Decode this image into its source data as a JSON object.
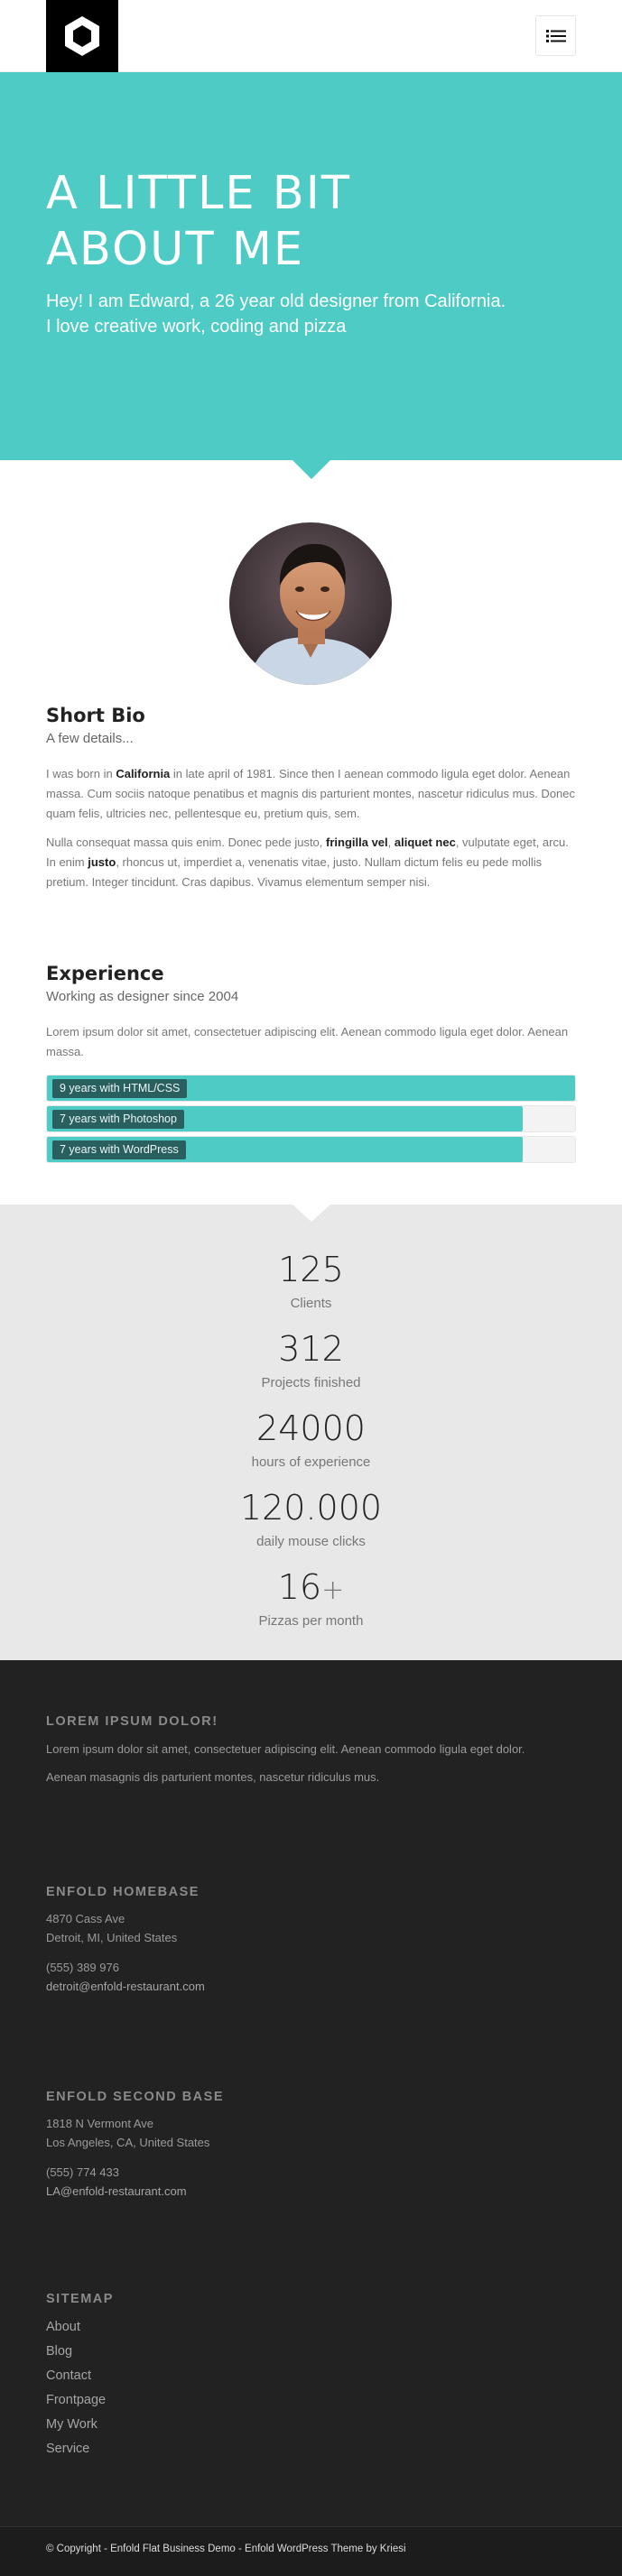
{
  "header": {
    "logo_icon": "hexagon-logo-icon",
    "menu_icon": "list-menu-icon"
  },
  "hero": {
    "title_line1": "A LITTLE BIT",
    "title_line2": "ABOUT ME",
    "subtitle_line1": "Hey! I am Edward, a 26 year old designer from California.",
    "subtitle_line2": "I love creative work, coding and pizza",
    "bg_color": "#4ecbc4"
  },
  "bio": {
    "title": "Short Bio",
    "subtitle": "A few details...",
    "p1": {
      "a": "I was born in ",
      "b": "California",
      "c": " in late april of 1981. Since then I aenean commodo ligula eget dolor. Aenean massa. Cum sociis natoque penatibus et magnis dis parturient montes, nascetur ridiculus mus. Donec quam felis, ultricies nec, pellentesque eu, pretium quis, sem."
    },
    "p2": {
      "a": "Nulla consequat massa quis enim. Donec pede justo, ",
      "b": "fringilla vel",
      "c": ", ",
      "d": "aliquet nec",
      "e": ", vulputate eget, arcu. In enim ",
      "f": "justo",
      "g": ", rhoncus ut, imperdiet a, venenatis vitae, justo. Nullam dictum felis eu pede mollis pretium. Integer tincidunt. Cras dapibus. Vivamus elementum semper nisi."
    }
  },
  "experience": {
    "title": "Experience",
    "subtitle": "Working as designer since 2004",
    "text": "Lorem ipsum dolor sit amet, consectetuer adipiscing elit. Aenean commodo ligula eget dolor. Aenean massa.",
    "skills": [
      {
        "label": "9 years with HTML/CSS",
        "level": 1.0
      },
      {
        "label": "7 years with Photoshop",
        "level": 0.9
      },
      {
        "label": "7 years with WordPress",
        "level": 0.9
      }
    ]
  },
  "stats": [
    {
      "value": "125",
      "suffix": "",
      "label": "Clients"
    },
    {
      "value": "312",
      "suffix": "",
      "label": "Projects finished"
    },
    {
      "value": "24000",
      "suffix": "",
      "label": "hours of experience"
    },
    {
      "value": "120.000",
      "suffix": "",
      "label": "daily mouse clicks"
    },
    {
      "value": "16",
      "suffix": "+",
      "label": "Pizzas per month"
    }
  ],
  "footer": {
    "lorem": {
      "title": "LOREM IPSUM DOLOR!",
      "p1": "Lorem ipsum dolor sit amet, consectetuer adipiscing elit. Aenean commodo ligula eget dolor.",
      "p2": "Aenean masagnis dis parturient montes, nascetur ridiculus mus."
    },
    "homebase": {
      "title": "ENFOLD HOMEBASE",
      "address1": "4870 Cass Ave",
      "address2": "Detroit, MI, United States",
      "phone": "(555) 389 976",
      "email": "detroit@enfold-restaurant.com"
    },
    "secondbase": {
      "title": "ENFOLD SECOND BASE",
      "address1": "1818 N Vermont Ave",
      "address2": "Los Angeles, CA, United States",
      "phone": "(555) 774 433",
      "email": "LA@enfold-restaurant.com"
    },
    "sitemap": {
      "title": "SITEMAP",
      "links": [
        "About",
        "Blog",
        "Contact",
        "Frontpage",
        "My Work",
        "Service"
      ]
    },
    "copyright": "© Copyright - Enfold Flat Business Demo - Enfold WordPress Theme by Kriesi"
  }
}
